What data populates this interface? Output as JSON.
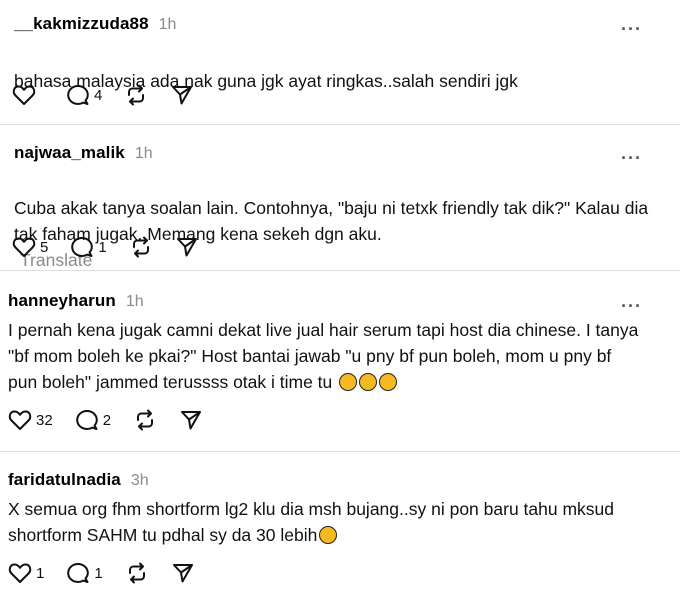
{
  "comments": [
    {
      "username": "__kakmizzuda88",
      "time": "1h",
      "text": "bahasa malaysia ada nak guna jgk ayat ringkas..salah sendiri jgk",
      "translate": "",
      "emojis": [],
      "likes": "",
      "replies": "4"
    },
    {
      "username": "najwaa_malik",
      "time": "1h",
      "text": "Cuba akak tanya soalan lain. Contohnya, \"baju ni tetxk friendly tak dik?\" Kalau dia\ntak faham jugak. Memang kena sekeh dgn aku.",
      "translate": "Translate",
      "emojis": [],
      "likes": "5",
      "replies": "1"
    },
    {
      "username": "hanneyharun",
      "time": "1h",
      "text": "I pernah kena jugak camni dekat live jual hair serum tapi host dia chinese. I tanya\n\"bf mom boleh ke pkai?\" Host bantai jawab \"u pny bf pun boleh, mom u pny bf\npun boleh\" jammed terussss otak i time tu ",
      "translate": "",
      "emojis": [
        "rofl-emoji",
        "rofl-emoji",
        "rofl-emoji"
      ],
      "likes": "32",
      "replies": "2"
    },
    {
      "username": "faridatulnadia",
      "time": "3h",
      "text": "X semua org fhm shortform lg2 klu dia msh bujang..sy ni pon baru tahu mksud\nshortform SAHM tu pdhal sy da 30 lebih",
      "translate": "",
      "emojis": [
        "sweat-smile-emoji"
      ],
      "likes": "1",
      "replies": "1"
    }
  ],
  "more_label": "···"
}
